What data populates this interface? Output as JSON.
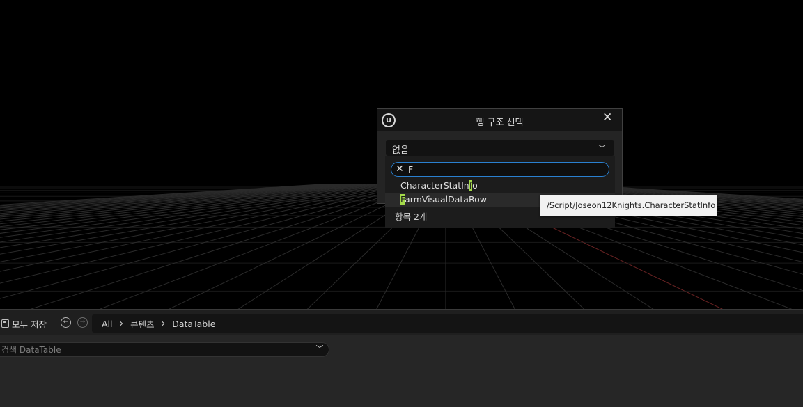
{
  "dialog": {
    "title": "행 구조 선택",
    "logo_icon": "unreal-engine-logo",
    "combo_value": "없음"
  },
  "dropdown": {
    "filter_value": "F",
    "items": [
      {
        "prefix": "CharacterStatIn",
        "match": "f",
        "suffix": "o"
      },
      {
        "prefix": "",
        "match": "F",
        "suffix": "armVisualDataRow"
      }
    ],
    "count_label": "항목 2개",
    "highlight_color": "#a3d94a"
  },
  "tooltip": {
    "text": "/Script/Joseon12Knights.CharacterStatInfo"
  },
  "content_browser": {
    "save_all_label": "모두 저장",
    "breadcrumb": [
      "All",
      "콘텐츠",
      "DataTable"
    ],
    "search_placeholder": "검색 DataTable"
  },
  "colors": {
    "focus_border": "#2a80d0",
    "grid_line": "#2b2b2b",
    "axis_red": "#6a2323"
  }
}
